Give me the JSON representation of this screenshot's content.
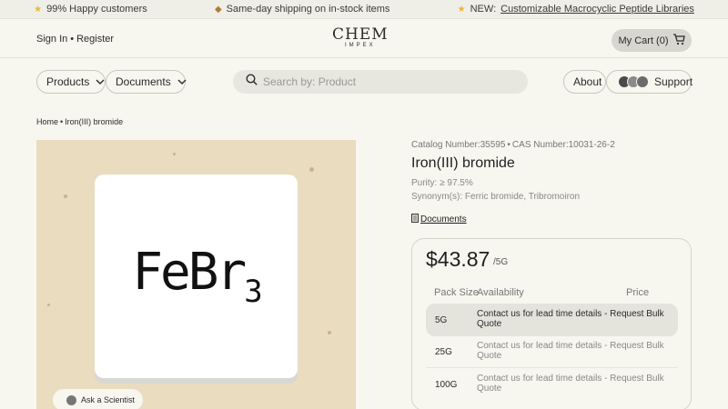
{
  "promo": {
    "items": [
      {
        "icon": "star-icon",
        "text": "99% Happy customers"
      },
      {
        "icon": "box-icon",
        "text": "Same-day shipping on in-stock items"
      },
      {
        "icon": "star-icon",
        "prefix": "NEW:",
        "link": "Customizable Macrocyclic Peptide Libraries"
      }
    ]
  },
  "header": {
    "sign_in": "Sign In",
    "separator": "•",
    "register": "Register",
    "logo_main": "CHEM",
    "logo_sub": "IMPEX",
    "cart_label": "My Cart (0)"
  },
  "nav": {
    "products": "Products",
    "documents": "Documents",
    "search_placeholder": "Search by: Product",
    "about": "About",
    "support": "Support"
  },
  "breadcrumb": {
    "home": "Home",
    "separator": "•",
    "current": "Iron(III) bromide"
  },
  "product": {
    "formula_main": "FeBr",
    "formula_sub": "3",
    "ask_label": "Ask a Scientist",
    "catalog": "Catalog Number:35595",
    "cas": "CAS Number:10031-26-2",
    "separator": "•",
    "name": "Iron(III) bromide",
    "purity": "Purity: ≥ 97.5%",
    "synonyms": "Synonym(s): Ferric bromide, Tribromoiron",
    "documents_link": "Documents"
  },
  "pricing": {
    "price": "$43.87",
    "unit": "/5G",
    "headers": {
      "size": "Pack Size",
      "availability": "Availability",
      "price": "Price"
    },
    "rows": [
      {
        "size": "5G",
        "availability": "Contact us for lead time details - Request Bulk Quote",
        "selected": true
      },
      {
        "size": "25G",
        "availability": "Contact us for lead time details - Request Bulk Quote",
        "selected": false
      },
      {
        "size": "100G",
        "availability": "Contact us for lead time details - Request Bulk Quote",
        "selected": false
      }
    ]
  },
  "colors": {
    "background": "#f7f6ef",
    "accent_star": "#e8b83b",
    "image_bg": "#e9dcbf"
  }
}
